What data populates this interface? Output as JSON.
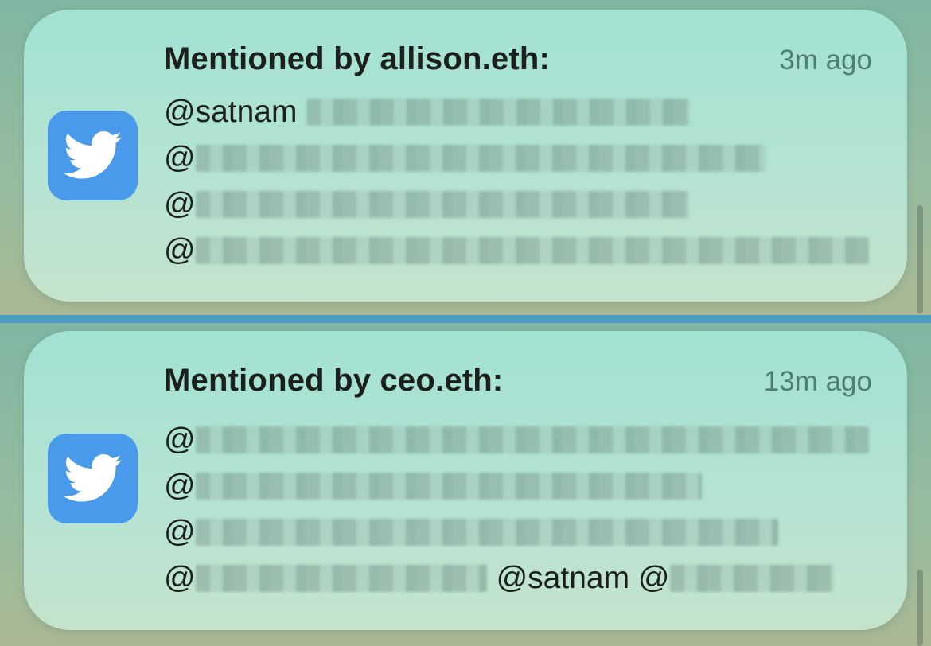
{
  "notifications": [
    {
      "app_icon": "twitter-bird-icon",
      "title": "Mentioned by allison.eth:",
      "time": "3m ago",
      "lines": [
        {
          "prefix": "@satnam",
          "redact_widths": [
            482
          ],
          "suffix": ""
        },
        {
          "prefix": "@",
          "redact_widths": [
            716
          ],
          "suffix": ""
        },
        {
          "prefix": "@",
          "redact_widths": [
            620
          ],
          "suffix": ""
        },
        {
          "prefix": "@",
          "redact_widths": [
            846
          ],
          "suffix": ""
        }
      ]
    },
    {
      "app_icon": "twitter-bird-icon",
      "title": "Mentioned by ceo.eth:",
      "time": "13m ago",
      "lines": [
        {
          "prefix": "@",
          "redact_widths": [
            846
          ],
          "suffix": ""
        },
        {
          "prefix": "@",
          "redact_widths": [
            636
          ],
          "suffix": ""
        },
        {
          "prefix": "@",
          "redact_widths": [
            732
          ],
          "suffix": ""
        },
        {
          "prefix": "@",
          "redact_widths": [
            366
          ],
          "suffix": "@satnam @",
          "tail_redact": 206
        }
      ]
    }
  ],
  "colors": {
    "card": "#b4e3d3",
    "icon_bg": "#4a9aec",
    "divider": "#4b9dc4",
    "time_text": "#4e7f72"
  }
}
